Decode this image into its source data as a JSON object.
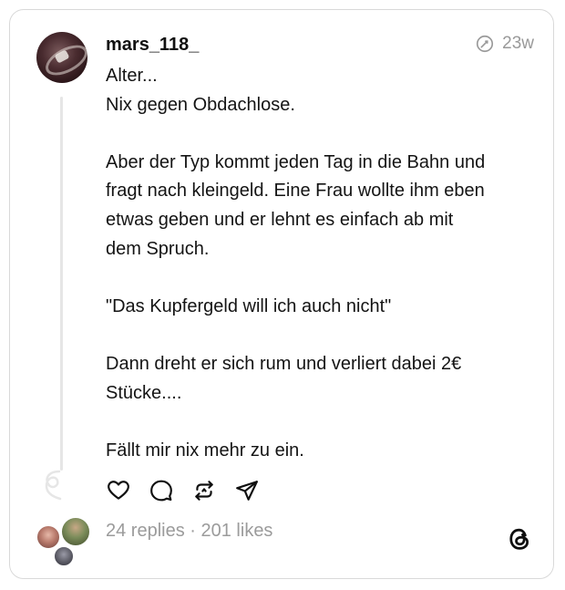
{
  "post": {
    "username": "mars_118_",
    "time": "23w",
    "lines": [
      "Alter...",
      "Nix gegen Obdachlose.",
      "",
      "Aber der Typ kommt jeden Tag in die Bahn und",
      "fragt nach kleingeld. Eine Frau wollte ihm eben",
      "etwas geben und er lehnt es einfach ab mit",
      "dem Spruch.",
      "",
      "\"Das Kupfergeld will ich auch nicht\"",
      "",
      "Dann dreht er sich rum und verliert dabei 2€",
      "Stücke....",
      "",
      "Fällt mir nix mehr zu ein."
    ]
  },
  "stats": {
    "replies": "24 replies",
    "separator": " · ",
    "likes": "201 likes"
  },
  "icons": {
    "time": "edited-clock-icon",
    "like": "heart-icon",
    "comment": "comment-icon",
    "repost": "repost-icon",
    "share": "send-icon",
    "brand": "threads-logo-icon"
  },
  "colors": {
    "text": "#101010",
    "muted": "#999999",
    "border": "#d9d9d9",
    "thread_line": "#e6e6e6"
  }
}
